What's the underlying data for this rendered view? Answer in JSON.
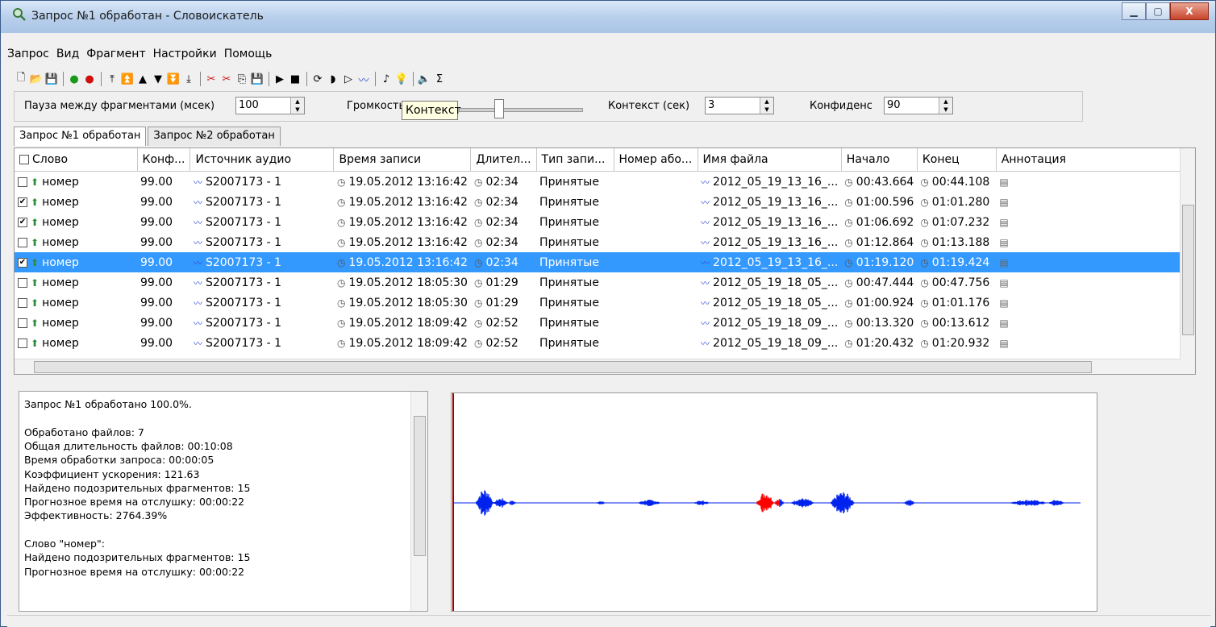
{
  "window": {
    "title": "Запрос №1 обработан - Словоискатель"
  },
  "menu": [
    "Запрос",
    "Вид",
    "Фрагмент",
    "Настройки",
    "Помощь"
  ],
  "toolbar_icons": [
    "new-icon",
    "open-icon",
    "save-icon",
    "start-icon",
    "stop-icon",
    "first-icon",
    "prev-page-icon",
    "prev-icon",
    "next-icon",
    "next-page-icon",
    "last-icon",
    "cut-icon",
    "cut-all-icon",
    "export-icon",
    "save-fragment-icon",
    "play-icon",
    "stop-play-icon",
    "loop-icon",
    "play-context-icon",
    "play-fragment-icon",
    "waveform-icon",
    "music-icon",
    "bulb-icon",
    "volume-icon",
    "sum-icon"
  ],
  "controls": {
    "pause_label": "Пауза между фрагментами (мсек)",
    "pause_value": "100",
    "volume_label": "Громкость",
    "tooltip": "Контекст",
    "context_label": "Контекст (сек)",
    "context_value": "3",
    "confidence_label": "Конфиденс",
    "confidence_value": "90"
  },
  "tabs": [
    "Запрос №1 обработан",
    "Запрос №2 обработан"
  ],
  "columns": [
    "Слово",
    "Конф...",
    "Источник аудио",
    "Время записи",
    "Длител...",
    "Тип запи...",
    "Номер або...",
    "Имя файла",
    "Начало",
    "Конец",
    "Аннотация"
  ],
  "rows": [
    {
      "checked": false,
      "word": "номер",
      "conf": "99.00",
      "source": "S2007173 - 1",
      "rec_time": "19.05.2012 13:16:42",
      "dur": "02:34",
      "type": "Принятые",
      "num": "",
      "file": "2012_05_19_13_16_...",
      "start": "00:43.664",
      "end": "00:44.108"
    },
    {
      "checked": true,
      "word": "номер",
      "conf": "99.00",
      "source": "S2007173 - 1",
      "rec_time": "19.05.2012 13:16:42",
      "dur": "02:34",
      "type": "Принятые",
      "num": "",
      "file": "2012_05_19_13_16_...",
      "start": "01:00.596",
      "end": "01:01.280"
    },
    {
      "checked": true,
      "word": "номер",
      "conf": "99.00",
      "source": "S2007173 - 1",
      "rec_time": "19.05.2012 13:16:42",
      "dur": "02:34",
      "type": "Принятые",
      "num": "",
      "file": "2012_05_19_13_16_...",
      "start": "01:06.692",
      "end": "01:07.232"
    },
    {
      "checked": false,
      "word": "номер",
      "conf": "99.00",
      "source": "S2007173 - 1",
      "rec_time": "19.05.2012 13:16:42",
      "dur": "02:34",
      "type": "Принятые",
      "num": "",
      "file": "2012_05_19_13_16_...",
      "start": "01:12.864",
      "end": "01:13.188"
    },
    {
      "checked": true,
      "selected": true,
      "word": "номер",
      "conf": "99.00",
      "source": "S2007173 - 1",
      "rec_time": "19.05.2012 13:16:42",
      "dur": "02:34",
      "type": "Принятые",
      "num": "",
      "file": "2012_05_19_13_16_...",
      "start": "01:19.120",
      "end": "01:19.424"
    },
    {
      "checked": false,
      "word": "номер",
      "conf": "99.00",
      "source": "S2007173 - 1",
      "rec_time": "19.05.2012 18:05:30",
      "dur": "01:29",
      "type": "Принятые",
      "num": "",
      "file": "2012_05_19_18_05_...",
      "start": "00:47.444",
      "end": "00:47.756"
    },
    {
      "checked": false,
      "word": "номер",
      "conf": "99.00",
      "source": "S2007173 - 1",
      "rec_time": "19.05.2012 18:05:30",
      "dur": "01:29",
      "type": "Принятые",
      "num": "",
      "file": "2012_05_19_18_05_...",
      "start": "01:00.924",
      "end": "01:01.176"
    },
    {
      "checked": false,
      "word": "номер",
      "conf": "99.00",
      "source": "S2007173 - 1",
      "rec_time": "19.05.2012 18:09:42",
      "dur": "02:52",
      "type": "Принятые",
      "num": "",
      "file": "2012_05_19_18_09_...",
      "start": "00:13.320",
      "end": "00:13.612"
    },
    {
      "checked": false,
      "word": "номер",
      "conf": "99.00",
      "source": "S2007173 - 1",
      "rec_time": "19.05.2012 18:09:42",
      "dur": "02:52",
      "type": "Принятые",
      "num": "",
      "file": "2012_05_19_18_09_...",
      "start": "01:20.432",
      "end": "01:20.932"
    }
  ],
  "log": [
    "Запрос №1 обработано 100.0%.",
    "",
    "Обработано файлов: 7",
    "Общая длительность файлов: 00:10:08",
    "Время обработки запроса: 00:00:05",
    "Коэффициент ускорения: 121.63",
    "Найдено подозрительных фрагментов: 15",
    "Прогнозное время на отслушку: 00:00:22",
    "Эффективность: 2764.39%",
    "",
    "Слово \"номер\":",
    "Найдено подозрительных фрагментов: 15",
    "Прогнозное время на отслушку: 00:00:22"
  ],
  "waveform": {
    "color": "#0022ee",
    "highlight_color": "#ff0000"
  }
}
